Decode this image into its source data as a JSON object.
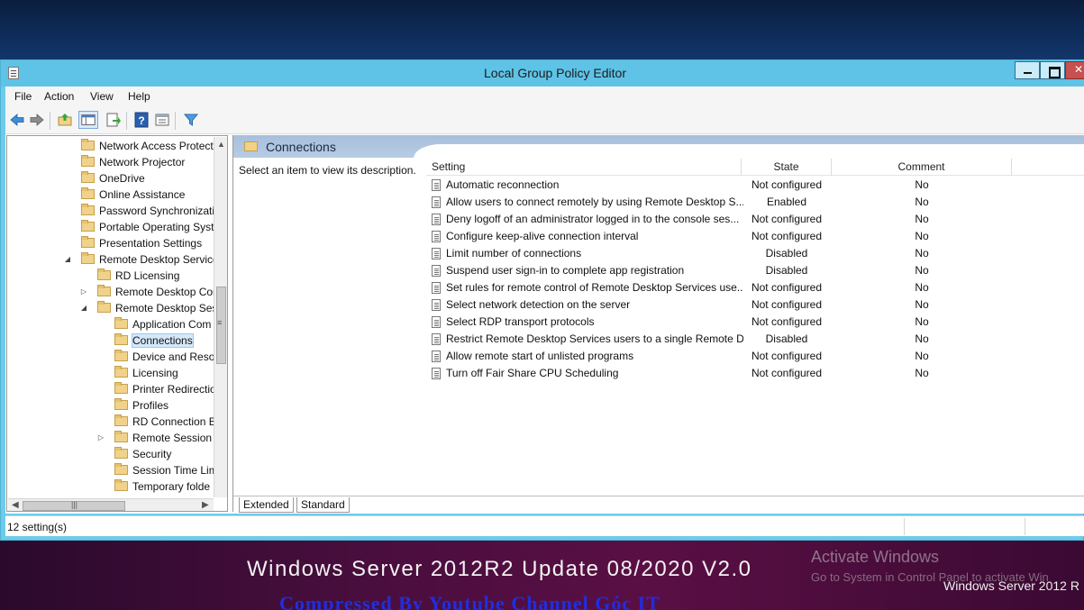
{
  "window": {
    "title": "Local Group Policy Editor"
  },
  "menu": {
    "file": "File",
    "action": "Action",
    "view": "View",
    "help": "Help"
  },
  "tree": {
    "items": [
      {
        "label": "Network Access Protecti",
        "level": 1,
        "expander": ""
      },
      {
        "label": "Network Projector",
        "level": 1,
        "expander": ""
      },
      {
        "label": "OneDrive",
        "level": 1,
        "expander": ""
      },
      {
        "label": "Online Assistance",
        "level": 1,
        "expander": ""
      },
      {
        "label": "Password Synchronizatio",
        "level": 1,
        "expander": ""
      },
      {
        "label": "Portable Operating Syste",
        "level": 1,
        "expander": ""
      },
      {
        "label": "Presentation Settings",
        "level": 1,
        "expander": ""
      },
      {
        "label": "Remote Desktop Service",
        "level": 1,
        "expander": "expanded"
      },
      {
        "label": "RD Licensing",
        "level": 2,
        "expander": ""
      },
      {
        "label": "Remote Desktop Con",
        "level": 2,
        "expander": "collapsed"
      },
      {
        "label": "Remote Desktop Sess",
        "level": 2,
        "expander": "expanded"
      },
      {
        "label": "Application Com",
        "level": 3,
        "expander": ""
      },
      {
        "label": "Connections",
        "level": 3,
        "expander": "",
        "selected": true
      },
      {
        "label": "Device and Resou",
        "level": 3,
        "expander": ""
      },
      {
        "label": "Licensing",
        "level": 3,
        "expander": ""
      },
      {
        "label": "Printer Redirectio",
        "level": 3,
        "expander": ""
      },
      {
        "label": "Profiles",
        "level": 3,
        "expander": ""
      },
      {
        "label": "RD Connection B",
        "level": 3,
        "expander": ""
      },
      {
        "label": "Remote Session E",
        "level": 3,
        "expander": "collapsed"
      },
      {
        "label": "Security",
        "level": 3,
        "expander": ""
      },
      {
        "label": "Session Time Lim",
        "level": 3,
        "expander": ""
      },
      {
        "label": "Temporary folde",
        "level": 3,
        "expander": ""
      }
    ]
  },
  "details": {
    "header_title": "Connections",
    "description_prompt": "Select an item to view its description.",
    "columns": [
      "Setting",
      "State",
      "Comment"
    ],
    "rows": [
      {
        "setting": "Automatic reconnection",
        "state": "Not configured",
        "comment": "No"
      },
      {
        "setting": "Allow users to connect remotely by using Remote Desktop S...",
        "state": "Enabled",
        "comment": "No"
      },
      {
        "setting": "Deny logoff of an administrator logged in to the console ses...",
        "state": "Not configured",
        "comment": "No"
      },
      {
        "setting": "Configure keep-alive connection interval",
        "state": "Not configured",
        "comment": "No"
      },
      {
        "setting": "Limit number of connections",
        "state": "Disabled",
        "comment": "No"
      },
      {
        "setting": "Suspend user sign-in to complete app registration",
        "state": "Disabled",
        "comment": "No"
      },
      {
        "setting": "Set rules for remote control of Remote Desktop Services use...",
        "state": "Not configured",
        "comment": "No"
      },
      {
        "setting": "Select network detection on the server",
        "state": "Not configured",
        "comment": "No"
      },
      {
        "setting": "Select RDP transport protocols",
        "state": "Not configured",
        "comment": "No"
      },
      {
        "setting": "Restrict Remote Desktop Services users to a single Remote D...",
        "state": "Disabled",
        "comment": "No"
      },
      {
        "setting": "Allow remote start of unlisted programs",
        "state": "Not configured",
        "comment": "No"
      },
      {
        "setting": "Turn off Fair Share CPU Scheduling",
        "state": "Not configured",
        "comment": "No"
      }
    ],
    "tabs": [
      "Extended",
      "Standard"
    ],
    "active_tab": "Extended"
  },
  "status": {
    "text": "12 setting(s)"
  },
  "overlay": {
    "main_caption": "Windows Server 2012R2 Update 08/2020 V2.0",
    "sub_caption": "Compressed By Youtube Channel Góc IT",
    "activate_title": "Activate Windows",
    "activate_sub": "Go to System in Control Panel to activate Win",
    "server_label": "Windows Server 2012 R"
  },
  "colors": {
    "titlebar": "#5ec3e6",
    "pane_header": "#b7cce4",
    "selection": "#d5e8f9"
  },
  "icons": {
    "back": "back-arrow-icon",
    "forward": "forward-arrow-icon",
    "up": "folder-up-icon",
    "show_hide_tree": "console-tree-icon",
    "export": "export-list-icon",
    "help": "help-icon",
    "properties": "properties-icon",
    "filter": "filter-icon"
  }
}
